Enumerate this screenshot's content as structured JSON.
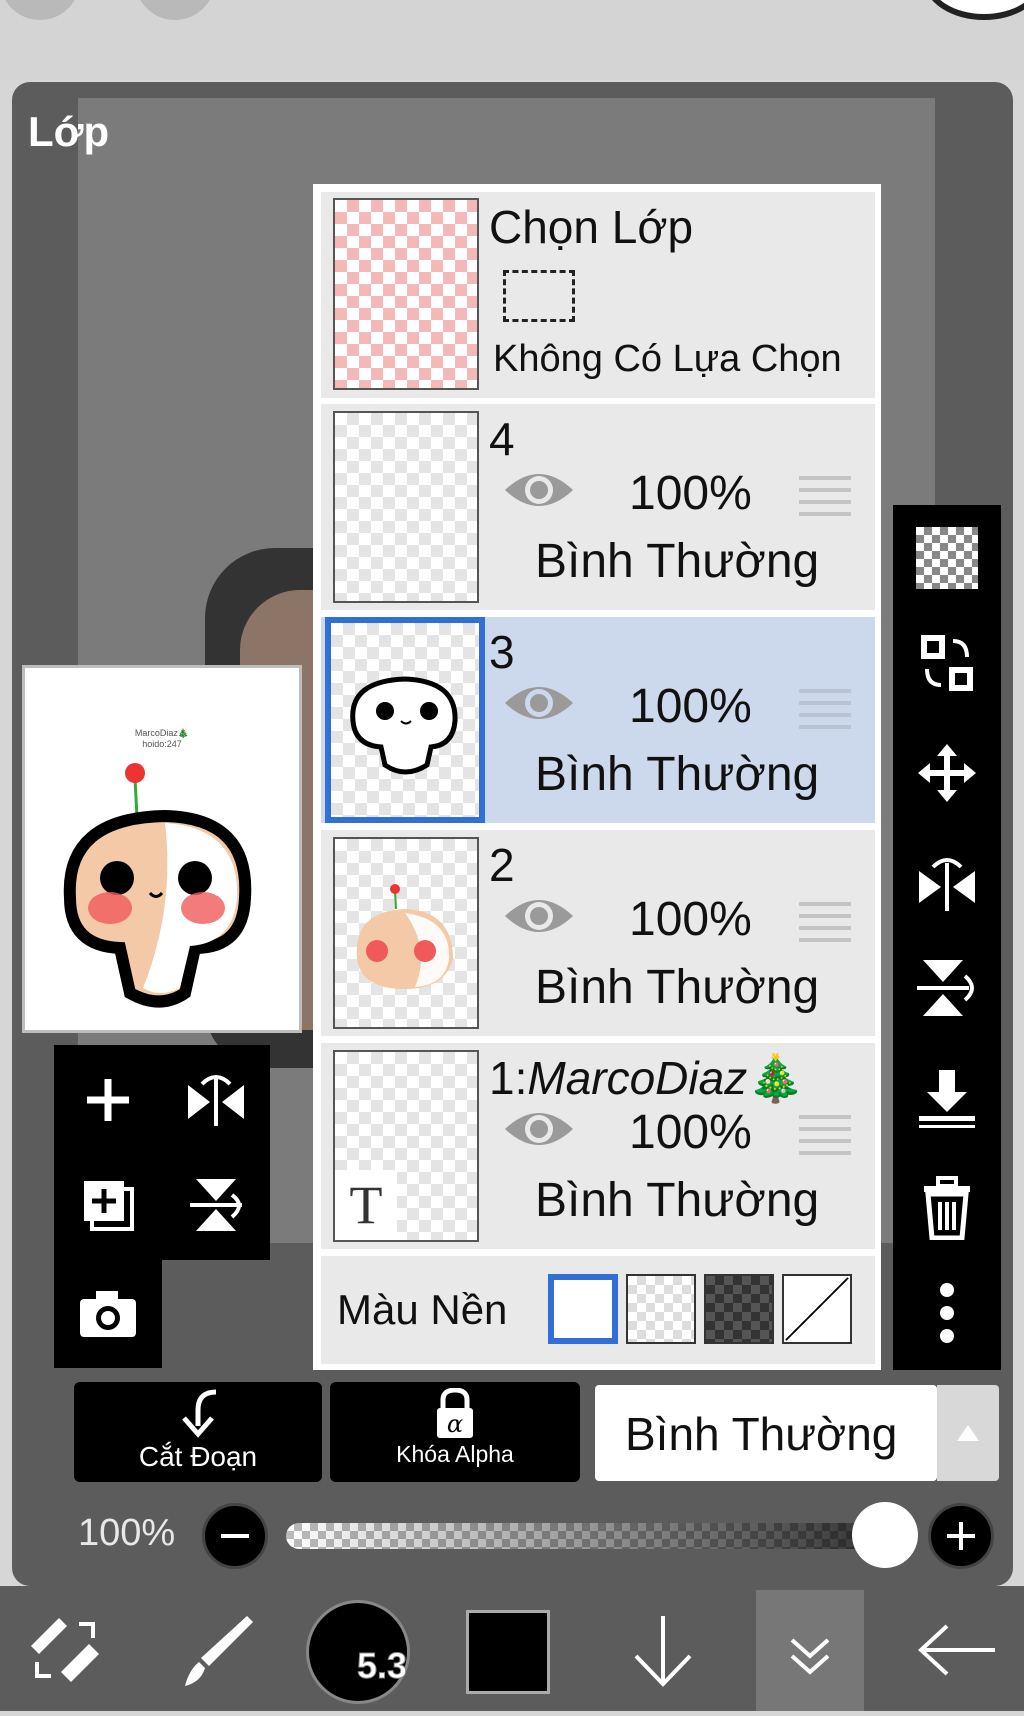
{
  "panel": {
    "title": "Lớp"
  },
  "preview": {
    "line1": "MarcoDiaz🎄",
    "line2": "hoido:247"
  },
  "layers": {
    "selection": {
      "title": "Chọn Lớp",
      "status": "Không Có Lựa Chọn"
    },
    "items": [
      {
        "name": "4",
        "opacity": "100%",
        "mode": "Bình Thường"
      },
      {
        "name": "3",
        "opacity": "100%",
        "mode": "Bình Thường"
      },
      {
        "name": "2",
        "opacity": "100%",
        "mode": "Bình Thường"
      },
      {
        "name_prefix": "1:",
        "name_italic": "MarcoDiaz",
        "name_emoji": "🎄",
        "opacity": "100%",
        "mode": "Bình Thường",
        "thumb_letter": "T"
      }
    ],
    "background": {
      "label": "Màu Nền"
    }
  },
  "toolbar": {
    "clip_label": "Cắt Đoạn",
    "alpha_lock_label": "Khóa Alpha",
    "blend_mode": "Bình Thường"
  },
  "opacity_slider": {
    "label": "100%",
    "value": 1.0
  },
  "bottom": {
    "brush_size": "5.3",
    "color": "#000000"
  },
  "colors": {
    "selected_row": "#ccd8ec",
    "selection_border": "#2f6fd6",
    "panel": "#5c5c5c"
  }
}
